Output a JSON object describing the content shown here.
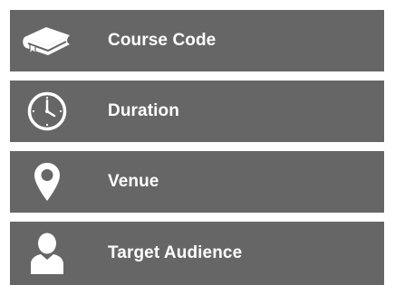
{
  "items": [
    {
      "label": "Course Code",
      "icon": "book-icon"
    },
    {
      "label": "Duration",
      "icon": "clock-icon"
    },
    {
      "label": "Venue",
      "icon": "location-pin-icon"
    },
    {
      "label": "Target Audience",
      "icon": "person-icon"
    }
  ],
  "colors": {
    "row_background": "#666666",
    "text": "#ffffff",
    "icon": "#ffffff"
  }
}
